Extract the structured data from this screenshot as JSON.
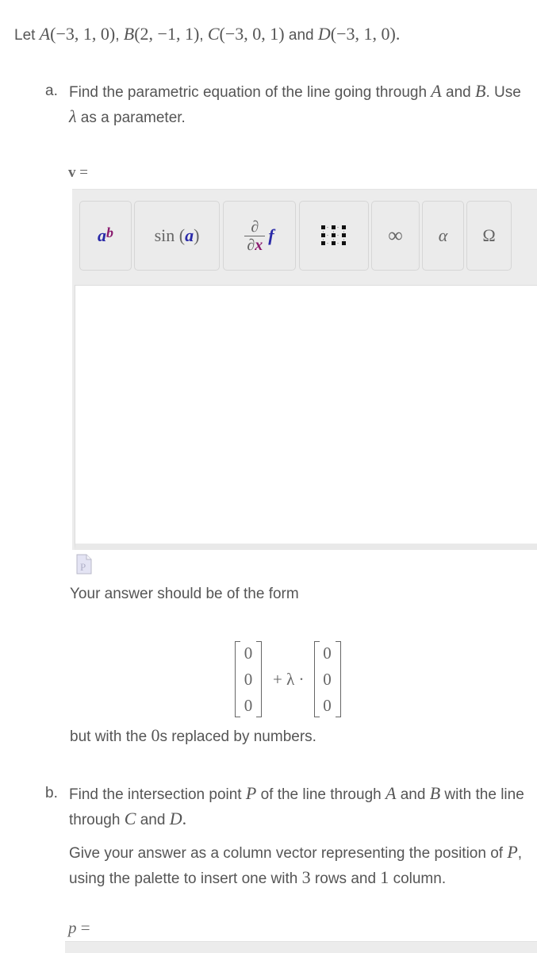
{
  "intro": {
    "prefix": "Let ",
    "points": [
      {
        "name": "A",
        "coords": "(−3, 1, 0)"
      },
      {
        "name": "B",
        "coords": "(2, −1, 1)"
      },
      {
        "name": "C",
        "coords": "(−3, 0, 1)"
      },
      {
        "name": "D",
        "coords": "(−3, 1, 0)"
      }
    ],
    "sep": ", ",
    "and": " and ",
    "end": "."
  },
  "part_a": {
    "label": "a.",
    "text1": "Find the parametric equation of the line going through ",
    "var_a": "A",
    "text2": " and ",
    "var_b": "B",
    "text3": ". Use ",
    "param": "λ",
    "text4": " as a parameter.",
    "answer_label_var": "v",
    "answer_label_eq": " ="
  },
  "palette": {
    "buttons": [
      {
        "name": "power",
        "base": "a",
        "exp": "b"
      },
      {
        "name": "function",
        "fn": "sin",
        "arg": "a"
      },
      {
        "name": "derivative",
        "num": "∂",
        "den_d": "∂",
        "den_x": "x",
        "f": "f"
      },
      {
        "name": "matrix"
      },
      {
        "name": "infinity",
        "glyph": "∞"
      },
      {
        "name": "greek",
        "glyph": "α"
      },
      {
        "name": "symbols",
        "glyph": "Ω"
      }
    ]
  },
  "answer_a": {
    "value": ""
  },
  "hint": {
    "text": "Your answer should be of the form",
    "vec1": [
      "0",
      "0",
      "0"
    ],
    "op": "+ λ ·",
    "vec2": [
      "0",
      "0",
      "0"
    ],
    "after_pre": "but with the ",
    "after_zero": "0",
    "after_post": "s replaced by numbers."
  },
  "part_b": {
    "label": "b.",
    "p1_t1": "Find the intersection point ",
    "p1_P": "P",
    "p1_t2": " of the line through ",
    "p1_A": "A",
    "p1_t3": " and ",
    "p1_B": "B",
    "p1_t4": " with the line through ",
    "p1_C": "C",
    "p1_t5": " and ",
    "p1_D": "D",
    "p1_t6": ".",
    "p2_t1": "Give your answer as a column vector representing the position of ",
    "p2_P": "P",
    "p2_t2": ", using the palette to insert one with ",
    "p2_rows": "3",
    "p2_t3": " rows and ",
    "p2_cols": "1",
    "p2_t4": " column.",
    "answer_label_var": "p",
    "answer_label_eq": " ="
  },
  "answer_b": {
    "value": ""
  }
}
